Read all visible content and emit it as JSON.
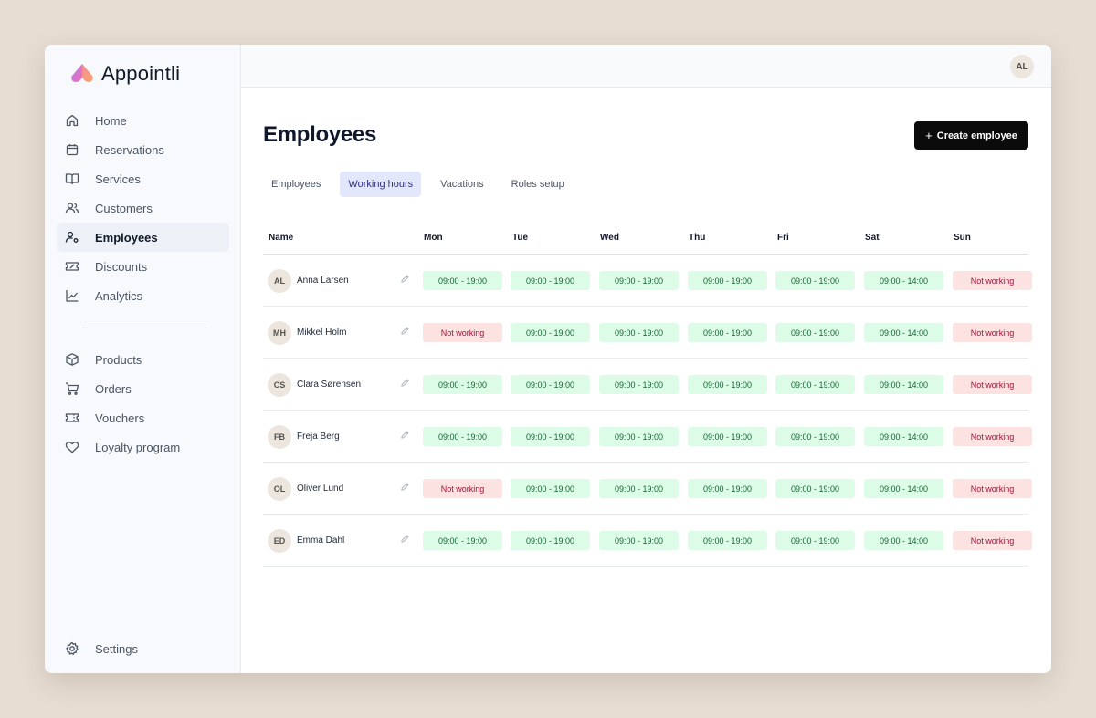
{
  "app": {
    "name": "Appointli"
  },
  "user": {
    "initials": "AL"
  },
  "sidebar": {
    "items": [
      {
        "label": "Home",
        "icon": "home-icon"
      },
      {
        "label": "Reservations",
        "icon": "calendar-icon"
      },
      {
        "label": "Services",
        "icon": "book-icon"
      },
      {
        "label": "Customers",
        "icon": "users-icon"
      },
      {
        "label": "Employees",
        "icon": "user-cog-icon",
        "active": true
      },
      {
        "label": "Discounts",
        "icon": "ticket-icon"
      },
      {
        "label": "Analytics",
        "icon": "chart-line-icon"
      }
    ],
    "secondary_items": [
      {
        "label": "Products",
        "icon": "box-icon"
      },
      {
        "label": "Orders",
        "icon": "cart-icon"
      },
      {
        "label": "Vouchers",
        "icon": "voucher-icon"
      },
      {
        "label": "Loyalty program",
        "icon": "heart-icon"
      }
    ],
    "settings": {
      "label": "Settings",
      "icon": "gear-icon"
    }
  },
  "page": {
    "title": "Employees",
    "create_button": "Create employee",
    "tabs": [
      "Employees",
      "Working hours",
      "Vacations",
      "Roles setup"
    ],
    "active_tab": "Working hours"
  },
  "table": {
    "headers": [
      "Name",
      "Mon",
      "Tue",
      "Wed",
      "Thu",
      "Fri",
      "Sat",
      "Sun"
    ],
    "rows": [
      {
        "initials": "AL",
        "name": "Anna Larsen",
        "hours": [
          "09:00 - 19:00",
          "09:00 - 19:00",
          "09:00 - 19:00",
          "09:00 - 19:00",
          "09:00 - 19:00",
          "09:00 - 14:00",
          "Not working"
        ]
      },
      {
        "initials": "MH",
        "name": "Mikkel Holm",
        "hours": [
          "Not working",
          "09:00 - 19:00",
          "09:00 - 19:00",
          "09:00 - 19:00",
          "09:00 - 19:00",
          "09:00 - 14:00",
          "Not working"
        ]
      },
      {
        "initials": "CS",
        "name": "Clara Sørensen",
        "hours": [
          "09:00 - 19:00",
          "09:00 - 19:00",
          "09:00 - 19:00",
          "09:00 - 19:00",
          "09:00 - 19:00",
          "09:00 - 14:00",
          "Not working"
        ]
      },
      {
        "initials": "FB",
        "name": "Freja Berg",
        "hours": [
          "09:00 - 19:00",
          "09:00 - 19:00",
          "09:00 - 19:00",
          "09:00 - 19:00",
          "09:00 - 19:00",
          "09:00 - 14:00",
          "Not working"
        ]
      },
      {
        "initials": "OL",
        "name": "Oliver Lund",
        "hours": [
          "Not working",
          "09:00 - 19:00",
          "09:00 - 19:00",
          "09:00 - 19:00",
          "09:00 - 19:00",
          "09:00 - 14:00",
          "Not working"
        ]
      },
      {
        "initials": "ED",
        "name": "Emma Dahl",
        "hours": [
          "09:00 - 19:00",
          "09:00 - 19:00",
          "09:00 - 19:00",
          "09:00 - 19:00",
          "09:00 - 19:00",
          "09:00 - 14:00",
          "Not working"
        ]
      }
    ]
  },
  "colors": {
    "working_bg": "#dcfce7",
    "not_working_bg": "#fde2e2",
    "active_tab_bg": "#e3e7fb",
    "button_bg": "#0b0b0b"
  }
}
